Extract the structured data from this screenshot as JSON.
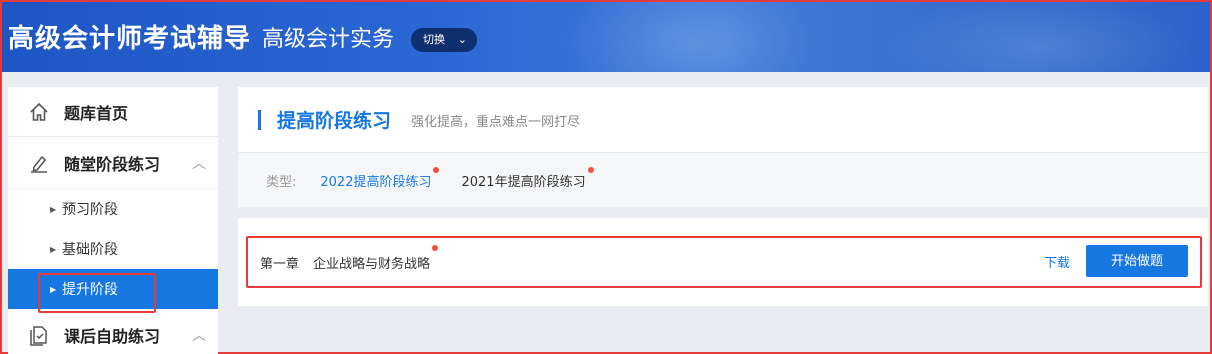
{
  "header": {
    "site_title": "高级会计师考试辅导",
    "subject_title": "高级会计实务",
    "switch_label": "切换"
  },
  "sidebar": {
    "home_label": "题库首页",
    "group1": {
      "label": "随堂阶段练习",
      "items": [
        {
          "label": "预习阶段"
        },
        {
          "label": "基础阶段"
        },
        {
          "label": "提升阶段"
        }
      ]
    },
    "group2": {
      "label": "课后自助练习"
    }
  },
  "main": {
    "section_title": "提高阶段练习",
    "section_desc": "强化提高，重点难点一网打尽",
    "type_label": "类型:",
    "types": [
      {
        "label": "2022提高阶段练习",
        "active": true
      },
      {
        "label": "2021年提高阶段练习",
        "active": false
      }
    ],
    "chapter": {
      "number": "第一章",
      "name": "企业战略与财务战略",
      "download_label": "下载",
      "start_label": "开始做题"
    }
  },
  "colors": {
    "accent": "#1677e0",
    "highlight_outline": "#e63b3b",
    "header_bg": "#2a67d4",
    "new_dot": "#f0503c"
  }
}
